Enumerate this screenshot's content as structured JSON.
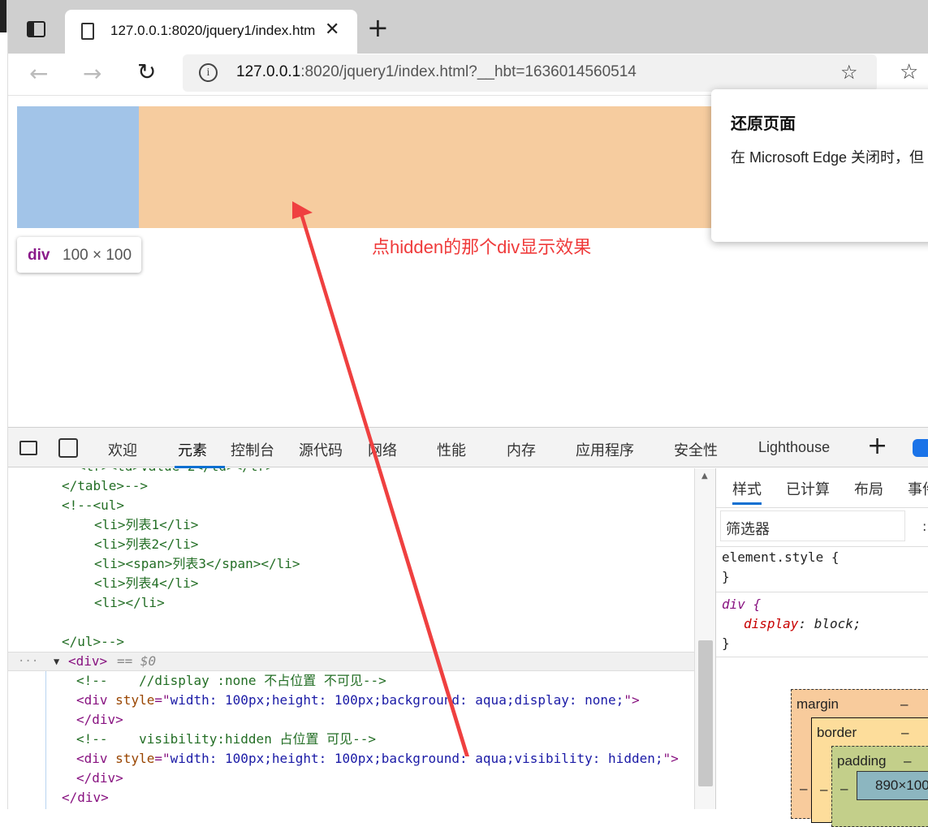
{
  "browser": {
    "tab_title": "127.0.0.1:8020/jquery1/index.htm",
    "url_host": "127.0.0.1",
    "url_rest": ":8020/jquery1/index.html?__hbt=1636014560514"
  },
  "page": {
    "tooltip_tag": "div",
    "tooltip_dims": "100 × 100",
    "annotation": "点hidden的那个div显示效果",
    "popup_title": "还原页面",
    "popup_body": "在 Microsoft Edge 关闭时，但"
  },
  "devtools": {
    "tabs": [
      "欢迎",
      "元素",
      "控制台",
      "源代码",
      "网络",
      "性能",
      "内存",
      "应用程序",
      "安全性",
      "Lighthouse"
    ],
    "active_tab": "元素",
    "code_lines": [
      "</table>-->",
      "<!--<ul>",
      "<li>列表1</li>",
      "<li>列表2</li>",
      "<li><span>列表3</span></li>",
      "<li>列表4</li>",
      "<li></li>",
      "",
      "</ul>-->",
      "<div>",
      "== $0",
      "<!--    //display :none 不占位置 不可见-->",
      "<div style=\"width: 100px;height: 100px;background: aqua;display: none;\">",
      "</div>",
      "<!--    visibility:hidden 占位置 可见-->",
      "<div style=\"width: 100px;height: 100px;background: aqua;visibility: hidden;\">",
      "</div>",
      "</div>"
    ],
    "styles_tabs": [
      "样式",
      "已计算",
      "布局",
      "事件"
    ],
    "filter_placeholder": "筛选器",
    "rule1": "element.style {",
    "rule1_close": "}",
    "rule2_sel": "div {",
    "rule2_prop": "display",
    "rule2_val": "block;",
    "rule2_close": "}",
    "box_margin": "margin",
    "box_border": "border",
    "box_padding": "padding",
    "box_dash": "–",
    "box_content": "890×100"
  }
}
